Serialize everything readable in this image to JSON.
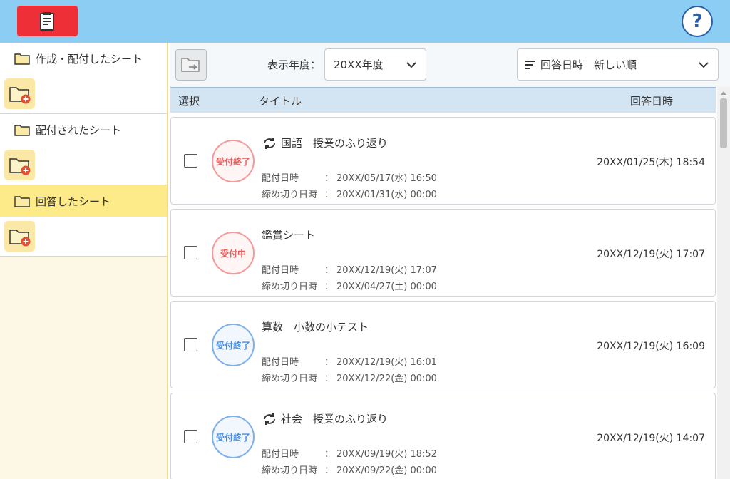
{
  "header": {
    "app_icon": "clipboard-note-icon",
    "help_label": "?",
    "help_icon": "question-circle-icon"
  },
  "sidebar": {
    "groups": [
      {
        "label": "作成・配付したシート",
        "active": false
      },
      {
        "label": "配付されたシート",
        "active": false
      },
      {
        "label": "回答したシート",
        "active": true
      }
    ],
    "add_folder_icon": "folder-add-icon"
  },
  "toolbar": {
    "move_icon": "folder-move-icon",
    "year_label": "表示年度：",
    "year_value": "20XX年度",
    "sort_value": "回答日時　新しい順"
  },
  "table": {
    "headers": {
      "select": "選択",
      "title": "タイトル",
      "answered": "回答日時"
    },
    "meta_keys": {
      "distributed": "配付日時",
      "deadline": "締め切り日時"
    },
    "meta_sep": "：",
    "rows": [
      {
        "status": "受付終了",
        "status_color": "red",
        "repeat": true,
        "title": "国語　授業のふり返り",
        "distributed": "20XX/05/17(水) 16:50",
        "deadline": "20XX/01/31(水) 00:00",
        "answered": "20XX/01/25(木) 18:54"
      },
      {
        "status": "受付中",
        "status_color": "red",
        "repeat": false,
        "title": "鑑賞シート",
        "distributed": "20XX/12/19(火) 17:07",
        "deadline": "20XX/04/27(土) 00:00",
        "answered": "20XX/12/19(火) 17:07"
      },
      {
        "status": "受付終了",
        "status_color": "blue",
        "repeat": false,
        "title": "算数　小数の小テスト",
        "distributed": "20XX/12/19(火) 16:01",
        "deadline": "20XX/12/22(金) 00:00",
        "answered": "20XX/12/19(火) 16:09"
      },
      {
        "status": "受付終了",
        "status_color": "blue",
        "repeat": true,
        "title": "社会　授業のふり返り",
        "distributed": "20XX/09/19(火) 18:52",
        "deadline": "20XX/09/22(金) 00:00",
        "answered": "20XX/12/19(火) 14:07"
      }
    ]
  },
  "colors": {
    "header_bg": "#8ccdf4",
    "app_button": "#ef2f37",
    "sidebar_active": "#fdea88",
    "table_header": "#d3e4f3",
    "status_red": "#e85c5c",
    "status_blue": "#4a8de0"
  }
}
